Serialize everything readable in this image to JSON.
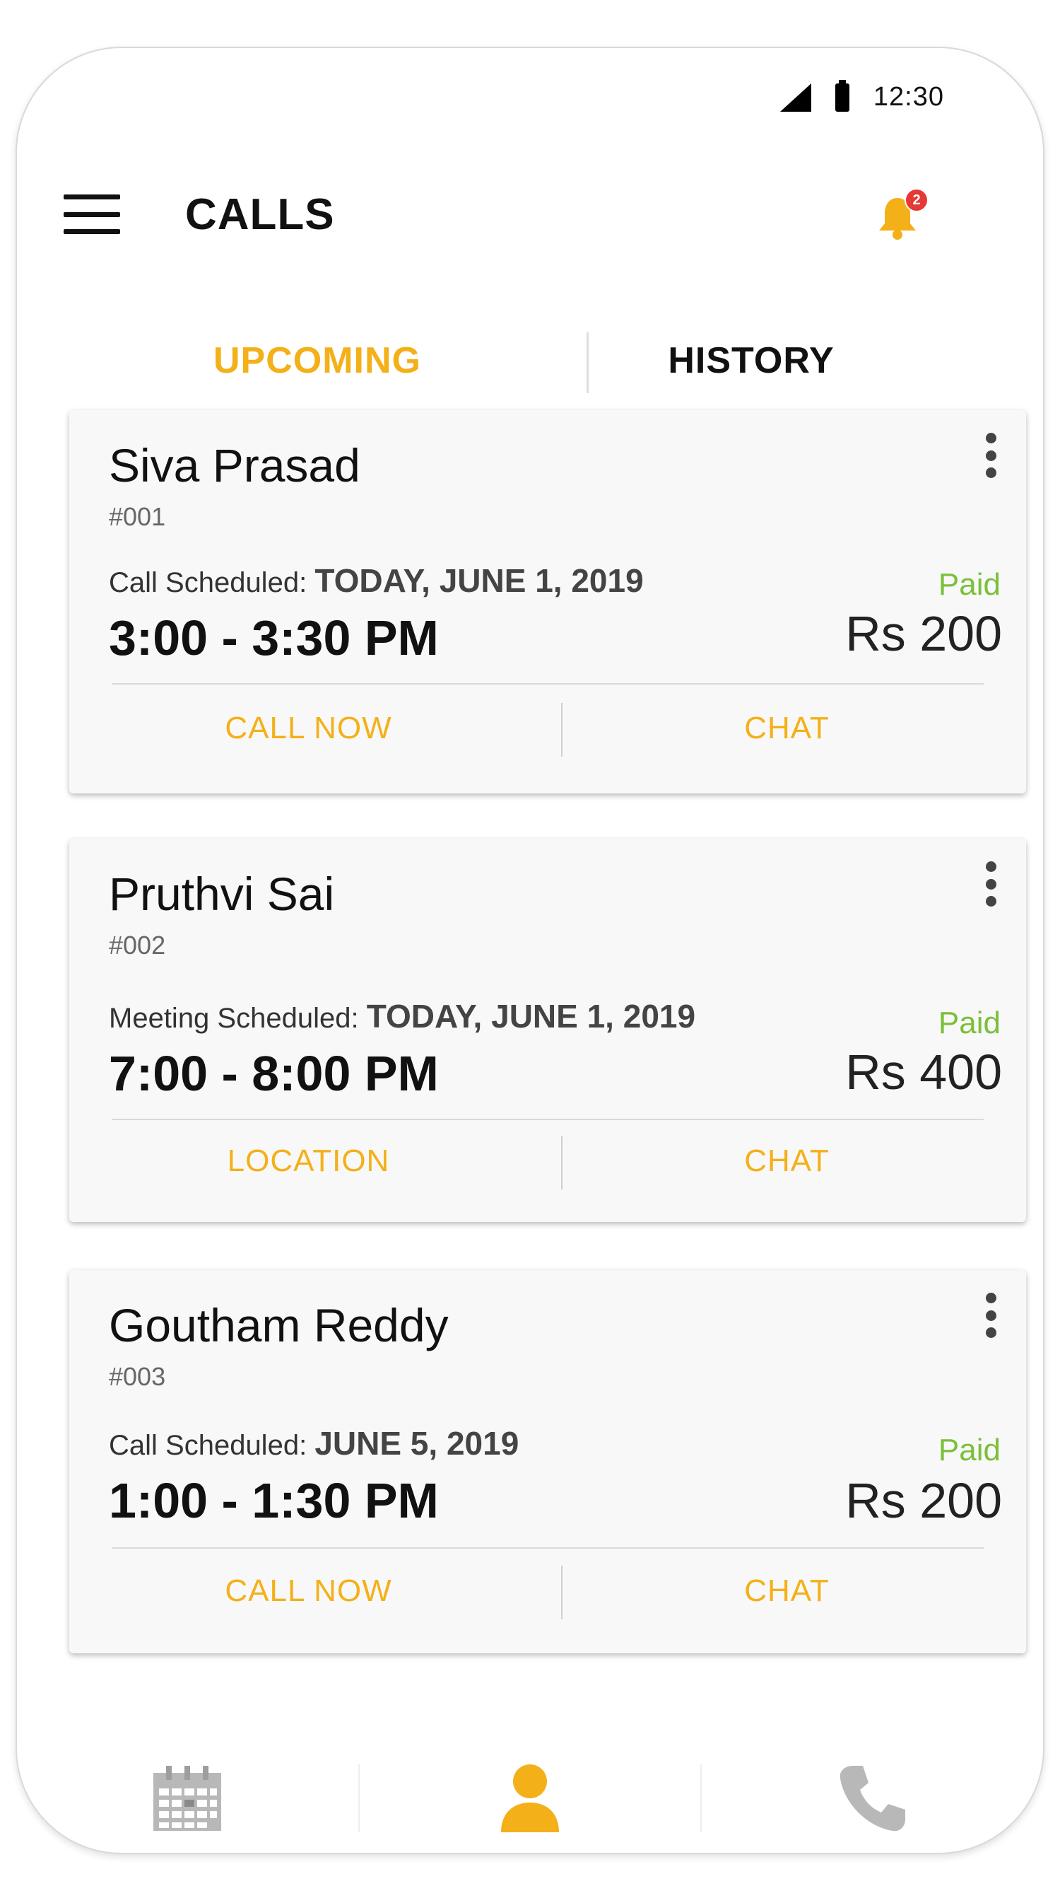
{
  "status_bar": {
    "time": "12:30"
  },
  "header": {
    "title": "CALLS",
    "notification_count": "2"
  },
  "tabs": [
    {
      "label": "UPCOMING",
      "active": true
    },
    {
      "label": "HISTORY",
      "active": false
    }
  ],
  "cards": [
    {
      "name": "Siva Prasad",
      "id": "#001",
      "schedule_label": "Call Scheduled:",
      "schedule_date": "TODAY, JUNE 1, 2019",
      "time": "3:00 - 3:30 PM",
      "payment_status": "Paid",
      "amount": "Rs 200",
      "primary_action": "CALL NOW",
      "secondary_action": "CHAT"
    },
    {
      "name": "Pruthvi Sai",
      "id": "#002",
      "schedule_label": "Meeting Scheduled:",
      "schedule_date": "TODAY, JUNE 1, 2019",
      "time": "7:00 - 8:00 PM",
      "payment_status": "Paid",
      "amount": "Rs 400",
      "primary_action": "LOCATION",
      "secondary_action": "CHAT"
    },
    {
      "name": "Goutham Reddy",
      "id": "#003",
      "schedule_label": "Call Scheduled:",
      "schedule_date": "JUNE 5, 2019",
      "time": "1:00 - 1:30 PM",
      "payment_status": "Paid",
      "amount": "Rs 200",
      "primary_action": "CALL NOW",
      "secondary_action": "CHAT"
    }
  ],
  "bottom_nav": [
    {
      "icon": "calendar-icon",
      "active": false
    },
    {
      "icon": "person-icon",
      "active": true
    },
    {
      "icon": "phone-icon",
      "active": false
    }
  ],
  "colors": {
    "accent": "#f4b019",
    "paid": "#7bbf3a",
    "badge": "#e53935",
    "inactive_icon": "#b8b8b8"
  }
}
